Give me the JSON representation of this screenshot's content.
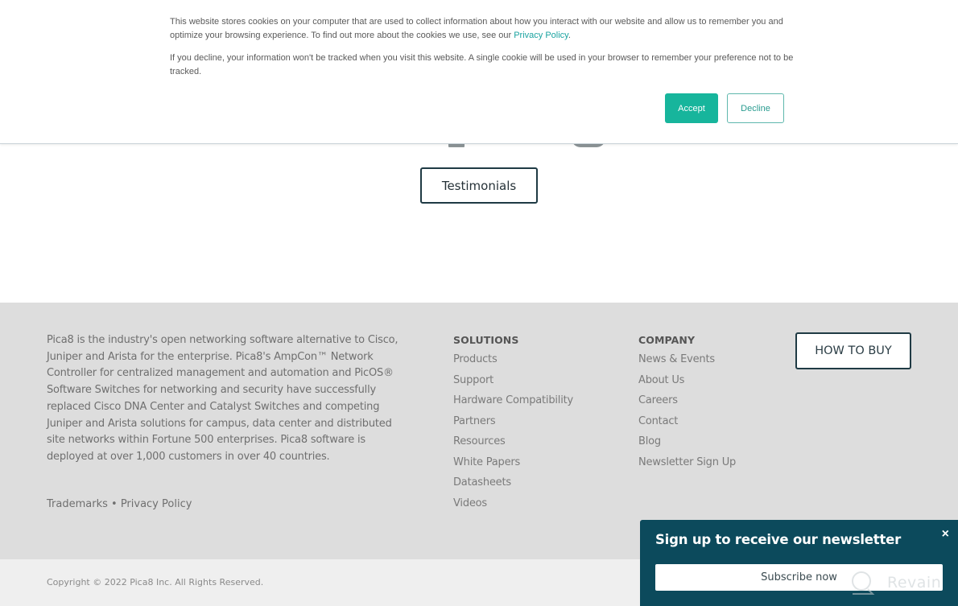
{
  "cookie_banner": {
    "text_1": "This website stores cookies on your computer that are used to collect information about how you interact with our website and allow us to remember you and optimize your browsing experience. To find out more about the cookies we use, see our ",
    "privacy_link": "Privacy Policy",
    "text_1_end": ".",
    "text_2": "If you decline, your information won't be tracked when you visit this website. A single cookie will be used in your browser to remember your preference not to be tracked.",
    "accept_label": "Accept",
    "decline_label": "Decline",
    "colors": {
      "accent": "#17b59c"
    }
  },
  "hero": {
    "testimonials_label": "Testimonials"
  },
  "footer": {
    "about_text": "Pica8 is the industry's open networking software alternative to Cisco, Juniper and Arista for the enterprise. Pica8's AmpCon™ Network Controller for centralized management and automation and PicOS® Software Switches for networking and security have successfully replaced Cisco DNA Center and Catalyst Switches and competing Juniper and Arista solutions for campus, data center and distributed site networks within Fortune 500 enterprises. Pica8 software is deployed at over 1,000 customers in over 40 countries.",
    "legal": {
      "trademarks": "Trademarks",
      "separator": " • ",
      "privacy": "Privacy Policy"
    },
    "solutions": {
      "heading": "SOLUTIONS",
      "links": [
        "Products",
        "Support",
        "Hardware Compatibility",
        "Partners",
        "Resources",
        "White Papers",
        "Datasheets",
        "Videos"
      ]
    },
    "company": {
      "heading": "COMPANY",
      "links": [
        "News & Events",
        "About Us",
        "Careers",
        "Contact",
        "Blog",
        "Newsletter Sign Up"
      ]
    },
    "how_to_buy_label": "HOW TO BUY",
    "copyright": "Copyright © 2022 Pica8 Inc. All Rights Reserved."
  },
  "newsletter": {
    "title": "Sign up to receive our newsletter",
    "close_icon": "×",
    "subscribe_label": "Subscribe now",
    "colors": {
      "background": "#0c4a5c"
    }
  },
  "watermark": {
    "text": "Revain"
  }
}
